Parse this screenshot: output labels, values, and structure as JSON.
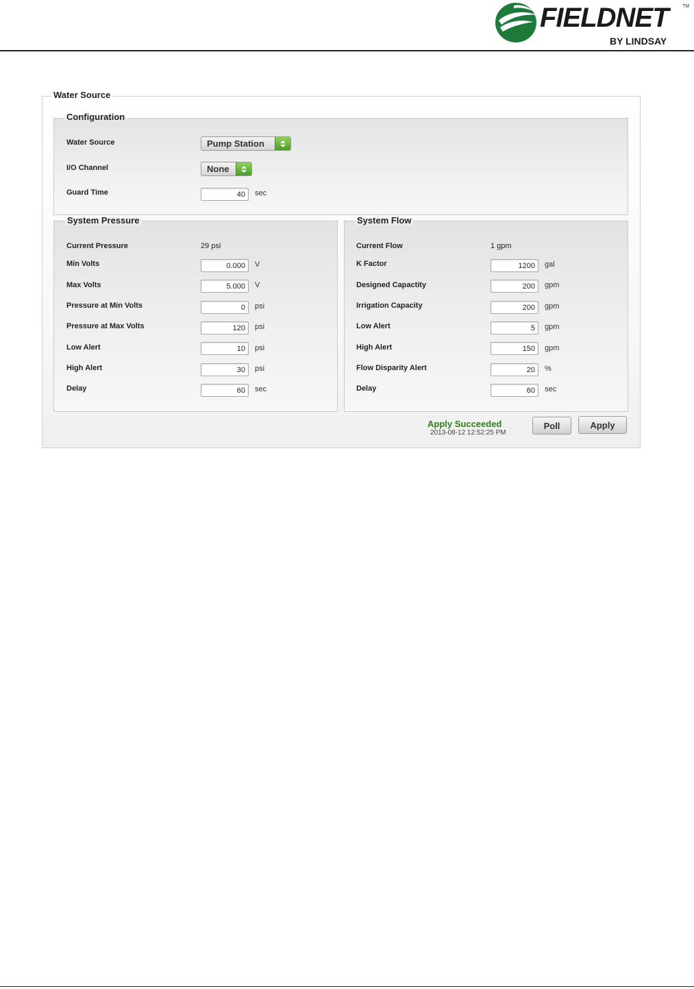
{
  "brand": {
    "name": "FIELDNET",
    "tm": "TM",
    "sub": "BY LINDSAY",
    "primary_color": "#1e7a3a"
  },
  "water_source_title": "Water Source",
  "configuration": {
    "title": "Configuration",
    "water_source_label": "Water Source",
    "water_source_value": "Pump Station",
    "io_channel_label": "I/O Channel",
    "io_channel_value": "None",
    "guard_time_label": "Guard Time",
    "guard_time_value": "40",
    "guard_time_unit": "sec"
  },
  "system_pressure": {
    "title": "System Pressure",
    "current_label": "Current Pressure",
    "current_value": "29 psi",
    "fields": [
      {
        "label": "Min Volts",
        "value": "0.000",
        "unit": "V"
      },
      {
        "label": "Max Volts",
        "value": "5.000",
        "unit": "V"
      },
      {
        "label": "Pressure at Min Volts",
        "value": "0",
        "unit": "psi"
      },
      {
        "label": "Pressure at Max Volts",
        "value": "120",
        "unit": "psi"
      },
      {
        "label": "Low Alert",
        "value": "10",
        "unit": "psi"
      },
      {
        "label": "High Alert",
        "value": "30",
        "unit": "psi"
      },
      {
        "label": "Delay",
        "value": "60",
        "unit": "sec"
      }
    ]
  },
  "system_flow": {
    "title": "System Flow",
    "current_label": "Current Flow",
    "current_value": "1 gpm",
    "fields": [
      {
        "label": "K Factor",
        "value": "1200",
        "unit": "gal"
      },
      {
        "label": "Designed Capactity",
        "value": "200",
        "unit": "gpm"
      },
      {
        "label": "Irrigation Capacity",
        "value": "200",
        "unit": "gpm"
      },
      {
        "label": "Low Alert",
        "value": "5",
        "unit": "gpm"
      },
      {
        "label": "High Alert",
        "value": "150",
        "unit": "gpm"
      },
      {
        "label": "Flow Disparity Alert",
        "value": "20",
        "unit": "%"
      },
      {
        "label": "Delay",
        "value": "60",
        "unit": "sec"
      }
    ]
  },
  "status": {
    "message": "Apply Succeeded",
    "timestamp": "2013-08-12 12:52:25 PM",
    "color": "#2e7d1a"
  },
  "actions": {
    "poll_label": "Poll",
    "apply_label": "Apply"
  }
}
